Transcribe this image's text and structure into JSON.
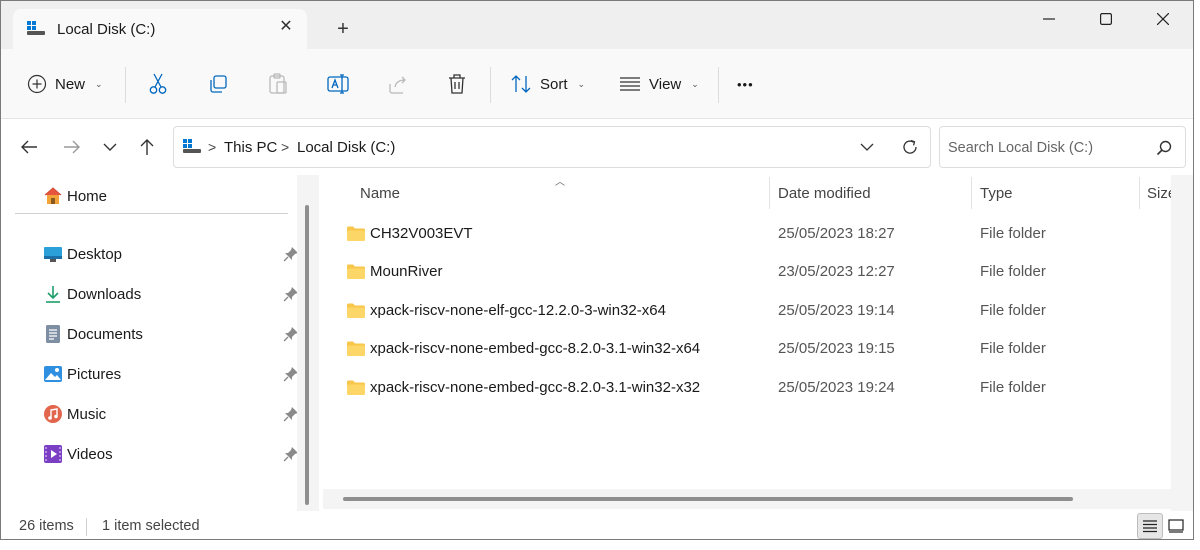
{
  "tab": {
    "title": "Local Disk (C:)",
    "close": "✕",
    "new_tab": "+"
  },
  "commands": {
    "new_label": "New",
    "sort_label": "Sort",
    "view_label": "View",
    "more": "•••"
  },
  "address": {
    "crumbs": [
      "This PC",
      "Local Disk (C:)"
    ],
    "separator": ">",
    "search_placeholder": "Search Local Disk (C:)"
  },
  "sidebar": {
    "home": "Home",
    "items": [
      {
        "label": "Desktop",
        "icon": "desktop-icon"
      },
      {
        "label": "Downloads",
        "icon": "downloads-icon"
      },
      {
        "label": "Documents",
        "icon": "documents-icon"
      },
      {
        "label": "Pictures",
        "icon": "pictures-icon"
      },
      {
        "label": "Music",
        "icon": "music-icon"
      },
      {
        "label": "Videos",
        "icon": "videos-icon"
      }
    ]
  },
  "columns": {
    "name": "Name",
    "date": "Date modified",
    "type": "Type",
    "size": "Size"
  },
  "files": [
    {
      "name": "CH32V003EVT",
      "date": "25/05/2023 18:27",
      "type": "File folder"
    },
    {
      "name": "MounRiver",
      "date": "23/05/2023 12:27",
      "type": "File folder"
    },
    {
      "name": "xpack-riscv-none-elf-gcc-12.2.0-3-win32-x64",
      "date": "25/05/2023 19:14",
      "type": "File folder"
    },
    {
      "name": "xpack-riscv-none-embed-gcc-8.2.0-3.1-win32-x64",
      "date": "25/05/2023 19:15",
      "type": "File folder"
    },
    {
      "name": "xpack-riscv-none-embed-gcc-8.2.0-3.1-win32-x32",
      "date": "25/05/2023 19:24",
      "type": "File folder"
    }
  ],
  "status": {
    "items": "26 items",
    "selected": "1 item selected"
  },
  "colors": {
    "folder": "#f7c64a",
    "accent": "#0067c0"
  }
}
